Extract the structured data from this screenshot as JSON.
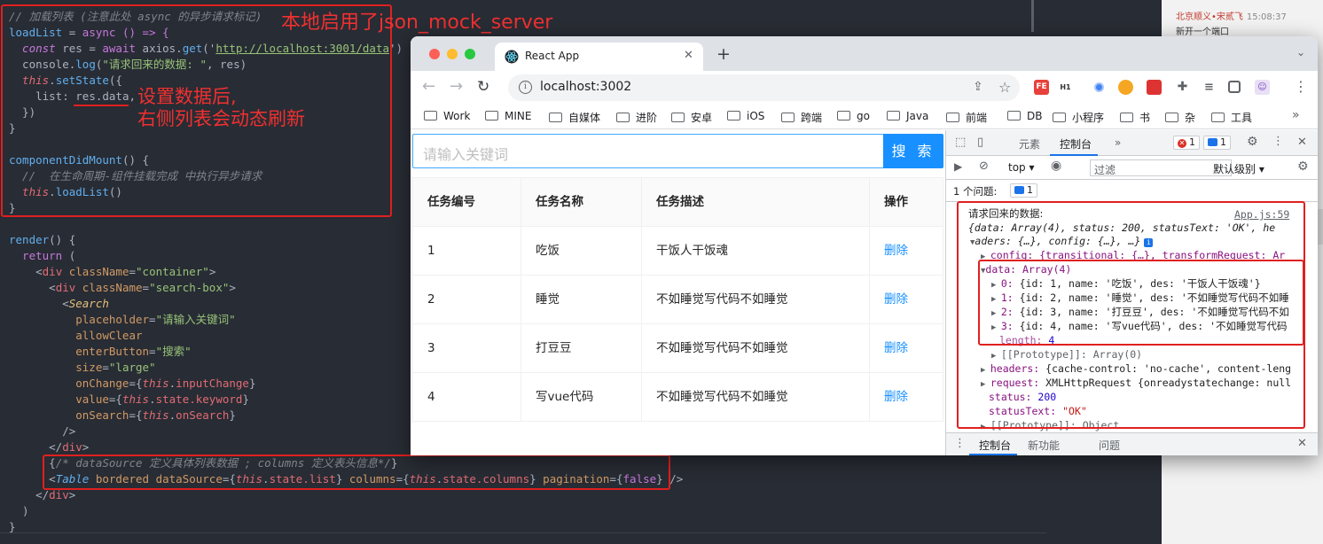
{
  "editor": {
    "code": {
      "l1": "// 加载列表 (注意此处 async 的异步请求标记)",
      "l2a": "loadList",
      "l2b": " = ",
      "l2c": "async",
      "l2d": " () => {",
      "l3a": "  const",
      "l3b": " res",
      "l3c": " = ",
      "l3d": "await",
      "l3e": " axios.",
      "l3f": "get",
      "l3g": "('",
      "l3h": "http://localhost:3001/data",
      "l3i": "')",
      "l4a": "  console.",
      "l4b": "log",
      "l4c": "(",
      "l4d": "\"请求回来的数据: \"",
      "l4e": ", res)",
      "l5a": "  this",
      "l5b": ".",
      "l5c": "setState",
      "l5d": "({",
      "l6a": "    list",
      "l6b": ": ",
      "l6c": "res.data",
      "l6d": ",",
      "l7": "  })",
      "l8": "}",
      "l9a": "componentDidMount",
      "l9b": "() {",
      "l10": "  //  在生命周期-组件挂载完成 中执行异步请求",
      "l11a": "  this",
      "l11b": ".",
      "l11c": "loadList",
      "l11d": "()",
      "l12": "}",
      "l13a": "render",
      "l13b": "() {",
      "l14a": "  return",
      "l14b": " (",
      "l15a": "    <",
      "l15b": "div",
      "l15c": " className",
      "l15d": "=",
      "l15e": "\"container\"",
      "l15f": ">",
      "l16a": "      <",
      "l16b": "div",
      "l16c": " className",
      "l16d": "=",
      "l16e": "\"search-box\"",
      "l16f": ">",
      "l17a": "        <",
      "l17b": "Search",
      "l18a": "          placeholder",
      "l18b": "=",
      "l18c": "\"请输入关键词\"",
      "l19": "          allowClear",
      "l20a": "          enterButton",
      "l20b": "=",
      "l20c": "\"搜索\"",
      "l21a": "          size",
      "l21b": "=",
      "l21c": "\"large\"",
      "l22a": "          onChange",
      "l22b": "={",
      "l22c": "this",
      "l22d": ".",
      "l22e": "inputChange",
      "l22f": "}",
      "l23a": "          value",
      "l23b": "={",
      "l23c": "this",
      "l23d": ".",
      "l23e": "state.keyword",
      "l23f": "}",
      "l24a": "          onSearch",
      "l24b": "={",
      "l24c": "this",
      "l24d": ".",
      "l24e": "onSearch",
      "l24f": "}",
      "l25": "        />",
      "l26a": "      </",
      "l26b": "div",
      "l26c": ">",
      "l27a": "      {",
      "l27b": "/* dataSource 定义具体列表数据 ; columns 定义表头信息*/",
      "l27c": "}",
      "l28a": "      <",
      "l28b": "Table",
      "l28c": " bordered",
      "l28d": " dataSource",
      "l28e": "={",
      "l28f": "this",
      "l28g": ".",
      "l28h": "state.list",
      "l28i": "}",
      "l28j": " columns",
      "l28k": "={",
      "l28l": "this",
      "l28m": ".",
      "l28n": "state.columns",
      "l28o": "}",
      "l28p": " pagination",
      "l28q": "={",
      "l28r": "false",
      "l28s": "}",
      "l28t": " />",
      "l29a": "    </",
      "l29b": "div",
      "l29c": ">",
      "l30": "  )",
      "l31": "}"
    },
    "annotations": {
      "top": "本地启用了json_mock_server",
      "mid1": "设置数据后,",
      "mid2": "右侧列表会动态刷新"
    }
  },
  "chat": {
    "sender": "北京顺义•宋贰飞",
    "time": "15:08:37",
    "message": "新开一个端口"
  },
  "browser": {
    "tab_title": "React App",
    "url": "localhost:3002",
    "extensions": [
      "FE",
      "H1"
    ],
    "bookmarks": [
      "Work",
      "MINE",
      "自媒体",
      "进阶",
      "安卓",
      "iOS",
      "跨端",
      "go",
      "Java",
      "前端",
      "DB",
      "小程序",
      "书",
      "杂",
      "工具"
    ],
    "bookmarks_more": "»"
  },
  "page": {
    "search_placeholder": "请输入关键词",
    "search_button": "搜 索",
    "table": {
      "headers": [
        "任务编号",
        "任务名称",
        "任务描述",
        "操作"
      ],
      "rows": [
        {
          "id": "1",
          "name": "吃饭",
          "des": "干饭人干饭魂",
          "action": "删除"
        },
        {
          "id": "2",
          "name": "睡觉",
          "des": "不如睡觉写代码不如睡觉",
          "action": "删除"
        },
        {
          "id": "3",
          "name": "打豆豆",
          "des": "不如睡觉写代码不如睡觉",
          "action": "删除"
        },
        {
          "id": "4",
          "name": "写vue代码",
          "des": "不如睡觉写代码不如睡觉",
          "action": "删除"
        }
      ]
    }
  },
  "devtools": {
    "tabs": [
      "元素",
      "控制台",
      "»"
    ],
    "errors": "1",
    "infos": "1",
    "context": "top ▾",
    "filter_placeholder": "过滤",
    "level": "默认级别 ▾",
    "issues_label": "1 个问题:",
    "issues_count": "1",
    "log_label": "请求回来的数据: ",
    "source_link": "App.js:59",
    "lines": {
      "obj1": "{data: Array(4), status: 200, statusText: 'OK', he",
      "obj2": "aders: {…}, config: {…}, …}",
      "config": "config: {transitional: {…}, transformRequest: Ar",
      "data": "data: Array(4)",
      "d0k": "0: ",
      "d0": "{id: 1, name: '吃饭', des: '干饭人干饭魂'}",
      "d1k": "1: ",
      "d1": "{id: 2, name: '睡觉', des: '不如睡觉写代码不如睡",
      "d2k": "2: ",
      "d2": "{id: 3, name: '打豆豆', des: '不如睡觉写代码不如",
      "d3k": "3: ",
      "d3": "{id: 4, name: '写vue代码', des: '不如睡觉写代码",
      "length_k": "length: ",
      "length_v": "4",
      "proto_arr": "[[Prototype]]: Array(0)",
      "headers_k": "headers: ",
      "headers_v": "{cache-control: 'no-cache', content-leng",
      "request_k": "request: ",
      "request_v": "XMLHttpRequest {onreadystatechange: null",
      "status_k": "status: ",
      "status_v": "200",
      "statusText_k": "statusText: ",
      "statusText_v": "\"OK\"",
      "proto_obj": "[[Prototype]]: Object"
    },
    "drawer_tabs": [
      "控制台",
      "新功能",
      "问题"
    ]
  }
}
